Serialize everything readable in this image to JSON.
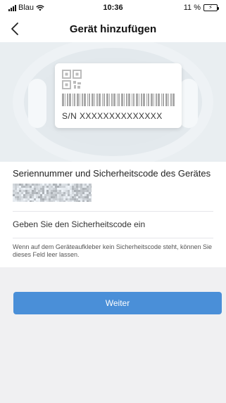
{
  "status_bar": {
    "carrier": "Blau",
    "time": "10:36",
    "battery": "11 %"
  },
  "nav": {
    "title": "Gerät hinzufügen",
    "back_icon": "chevron-left-icon"
  },
  "hero": {
    "serial_label": "S/N  XXXXXXXXXXXXXX"
  },
  "form": {
    "section_label": "Seriennummer und Sicherheitscode des Gerätes",
    "code_placeholder": "Geben Sie den Sicherheitscode ein",
    "hint": "Wenn auf dem Geräteaufkleber kein Sicherheitscode steht, können Sie dieses Feld leer lassen."
  },
  "actions": {
    "next_label": "Weiter"
  },
  "colors": {
    "accent": "#4a8fd8",
    "background": "#f0f0f2"
  }
}
